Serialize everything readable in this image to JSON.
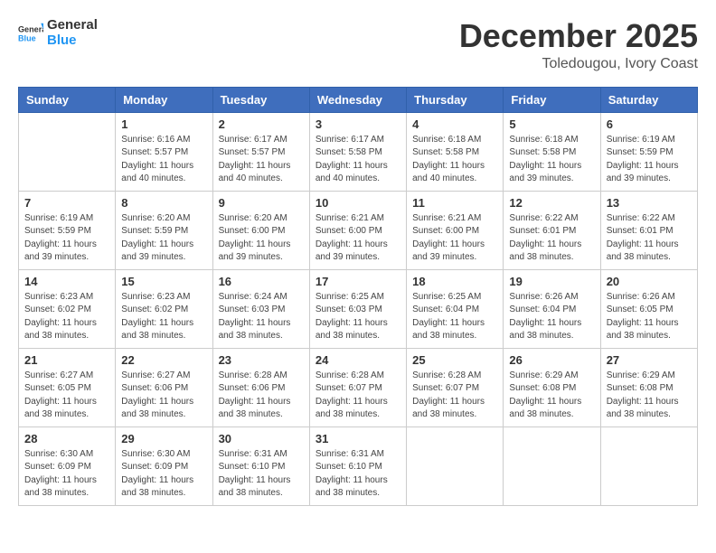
{
  "logo": {
    "general": "General",
    "blue": "Blue"
  },
  "title": "December 2025",
  "location": "Toledougou, Ivory Coast",
  "days_of_week": [
    "Sunday",
    "Monday",
    "Tuesday",
    "Wednesday",
    "Thursday",
    "Friday",
    "Saturday"
  ],
  "weeks": [
    [
      {
        "day": "",
        "info": ""
      },
      {
        "day": "1",
        "info": "Sunrise: 6:16 AM\nSunset: 5:57 PM\nDaylight: 11 hours and 40 minutes."
      },
      {
        "day": "2",
        "info": "Sunrise: 6:17 AM\nSunset: 5:57 PM\nDaylight: 11 hours and 40 minutes."
      },
      {
        "day": "3",
        "info": "Sunrise: 6:17 AM\nSunset: 5:58 PM\nDaylight: 11 hours and 40 minutes."
      },
      {
        "day": "4",
        "info": "Sunrise: 6:18 AM\nSunset: 5:58 PM\nDaylight: 11 hours and 40 minutes."
      },
      {
        "day": "5",
        "info": "Sunrise: 6:18 AM\nSunset: 5:58 PM\nDaylight: 11 hours and 39 minutes."
      },
      {
        "day": "6",
        "info": "Sunrise: 6:19 AM\nSunset: 5:59 PM\nDaylight: 11 hours and 39 minutes."
      }
    ],
    [
      {
        "day": "7",
        "info": "Sunrise: 6:19 AM\nSunset: 5:59 PM\nDaylight: 11 hours and 39 minutes."
      },
      {
        "day": "8",
        "info": "Sunrise: 6:20 AM\nSunset: 5:59 PM\nDaylight: 11 hours and 39 minutes."
      },
      {
        "day": "9",
        "info": "Sunrise: 6:20 AM\nSunset: 6:00 PM\nDaylight: 11 hours and 39 minutes."
      },
      {
        "day": "10",
        "info": "Sunrise: 6:21 AM\nSunset: 6:00 PM\nDaylight: 11 hours and 39 minutes."
      },
      {
        "day": "11",
        "info": "Sunrise: 6:21 AM\nSunset: 6:00 PM\nDaylight: 11 hours and 39 minutes."
      },
      {
        "day": "12",
        "info": "Sunrise: 6:22 AM\nSunset: 6:01 PM\nDaylight: 11 hours and 38 minutes."
      },
      {
        "day": "13",
        "info": "Sunrise: 6:22 AM\nSunset: 6:01 PM\nDaylight: 11 hours and 38 minutes."
      }
    ],
    [
      {
        "day": "14",
        "info": "Sunrise: 6:23 AM\nSunset: 6:02 PM\nDaylight: 11 hours and 38 minutes."
      },
      {
        "day": "15",
        "info": "Sunrise: 6:23 AM\nSunset: 6:02 PM\nDaylight: 11 hours and 38 minutes."
      },
      {
        "day": "16",
        "info": "Sunrise: 6:24 AM\nSunset: 6:03 PM\nDaylight: 11 hours and 38 minutes."
      },
      {
        "day": "17",
        "info": "Sunrise: 6:25 AM\nSunset: 6:03 PM\nDaylight: 11 hours and 38 minutes."
      },
      {
        "day": "18",
        "info": "Sunrise: 6:25 AM\nSunset: 6:04 PM\nDaylight: 11 hours and 38 minutes."
      },
      {
        "day": "19",
        "info": "Sunrise: 6:26 AM\nSunset: 6:04 PM\nDaylight: 11 hours and 38 minutes."
      },
      {
        "day": "20",
        "info": "Sunrise: 6:26 AM\nSunset: 6:05 PM\nDaylight: 11 hours and 38 minutes."
      }
    ],
    [
      {
        "day": "21",
        "info": "Sunrise: 6:27 AM\nSunset: 6:05 PM\nDaylight: 11 hours and 38 minutes."
      },
      {
        "day": "22",
        "info": "Sunrise: 6:27 AM\nSunset: 6:06 PM\nDaylight: 11 hours and 38 minutes."
      },
      {
        "day": "23",
        "info": "Sunrise: 6:28 AM\nSunset: 6:06 PM\nDaylight: 11 hours and 38 minutes."
      },
      {
        "day": "24",
        "info": "Sunrise: 6:28 AM\nSunset: 6:07 PM\nDaylight: 11 hours and 38 minutes."
      },
      {
        "day": "25",
        "info": "Sunrise: 6:28 AM\nSunset: 6:07 PM\nDaylight: 11 hours and 38 minutes."
      },
      {
        "day": "26",
        "info": "Sunrise: 6:29 AM\nSunset: 6:08 PM\nDaylight: 11 hours and 38 minutes."
      },
      {
        "day": "27",
        "info": "Sunrise: 6:29 AM\nSunset: 6:08 PM\nDaylight: 11 hours and 38 minutes."
      }
    ],
    [
      {
        "day": "28",
        "info": "Sunrise: 6:30 AM\nSunset: 6:09 PM\nDaylight: 11 hours and 38 minutes."
      },
      {
        "day": "29",
        "info": "Sunrise: 6:30 AM\nSunset: 6:09 PM\nDaylight: 11 hours and 38 minutes."
      },
      {
        "day": "30",
        "info": "Sunrise: 6:31 AM\nSunset: 6:10 PM\nDaylight: 11 hours and 38 minutes."
      },
      {
        "day": "31",
        "info": "Sunrise: 6:31 AM\nSunset: 6:10 PM\nDaylight: 11 hours and 38 minutes."
      },
      {
        "day": "",
        "info": ""
      },
      {
        "day": "",
        "info": ""
      },
      {
        "day": "",
        "info": ""
      }
    ]
  ]
}
